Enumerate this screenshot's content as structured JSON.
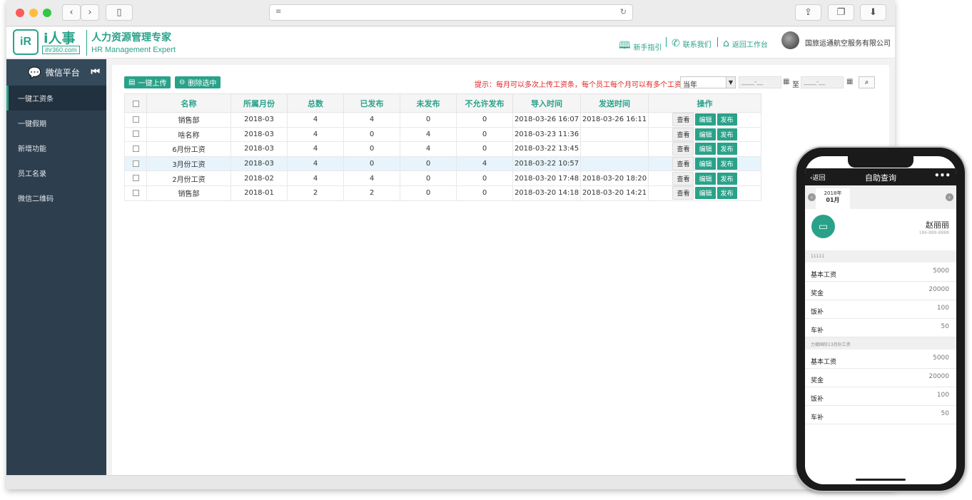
{
  "header": {
    "logo_name": "i人事",
    "logo_site": "ihr360.com",
    "brand_cn": "人力资源管理专家",
    "brand_en": "HR Management Expert",
    "links": [
      {
        "label": "新手指引",
        "icon": "book-icon"
      },
      {
        "label": "联系我们",
        "icon": "phone-icon"
      },
      {
        "label": "返回工作台",
        "icon": "home-icon"
      }
    ],
    "company": "国旅运通航空服务有限公司"
  },
  "sidebar": {
    "title": "微信平台",
    "items": [
      {
        "label": "一键工资条",
        "active": true
      },
      {
        "label": "一键假期",
        "active": false
      },
      {
        "label": "新增功能",
        "active": false
      },
      {
        "label": "员工名录",
        "active": false
      },
      {
        "label": "微信二维码",
        "active": false
      }
    ]
  },
  "toolbar": {
    "upload_label": "一键上传",
    "delete_label": "删除选中",
    "hint": "提示：每月可以多次上传工资条，每个员工每个月可以有多个工资条",
    "period_value": "当年",
    "date_from": "____-__",
    "date_to": "____-__",
    "to_label": "至"
  },
  "table": {
    "columns": [
      "名称",
      "所属月份",
      "总数",
      "已发布",
      "未发布",
      "不允许发布",
      "导入时间",
      "发送时间",
      "操作"
    ],
    "rows": [
      {
        "name": "销售部",
        "month": "2018-03",
        "total": "4",
        "published": "4",
        "unpublished": "0",
        "blocked": "0",
        "imported": "2018-03-26 16:07",
        "sent": "2018-03-26 16:11"
      },
      {
        "name": "啥名称",
        "month": "2018-03",
        "total": "4",
        "published": "0",
        "unpublished": "4",
        "blocked": "0",
        "imported": "2018-03-23 11:36",
        "sent": ""
      },
      {
        "name": "6月份工资",
        "month": "2018-03",
        "total": "4",
        "published": "0",
        "unpublished": "4",
        "blocked": "0",
        "imported": "2018-03-22 13:45",
        "sent": ""
      },
      {
        "name": "3月份工资",
        "month": "2018-03",
        "total": "4",
        "published": "0",
        "unpublished": "0",
        "blocked": "4",
        "imported": "2018-03-22 10:57",
        "sent": ""
      },
      {
        "name": "2月份工资",
        "month": "2018-02",
        "total": "4",
        "published": "4",
        "unpublished": "0",
        "blocked": "0",
        "imported": "2018-03-20 17:48",
        "sent": "2018-03-20 18:20"
      },
      {
        "name": "销售部",
        "month": "2018-01",
        "total": "2",
        "published": "2",
        "unpublished": "0",
        "blocked": "0",
        "imported": "2018-03-20 14:18",
        "sent": "2018-03-20 14:21"
      }
    ],
    "actions": {
      "view": "查看",
      "edit": "编辑",
      "publish": "发布"
    },
    "highlight_row": 3
  },
  "phone": {
    "back_label": "返回",
    "title": "自助查询",
    "more": "•••",
    "year": "2018年",
    "month": "01月",
    "employee_name": "赵丽丽",
    "employee_phone": "186-888-8888",
    "sections": [
      {
        "title": "11111",
        "items": [
          {
            "label": "基本工资",
            "value": "5000"
          },
          {
            "label": "奖金",
            "value": "20000"
          },
          {
            "label": "饭补",
            "value": "100"
          },
          {
            "label": "车补",
            "value": "50"
          }
        ]
      },
      {
        "title": "力德国际13月份工资",
        "items": [
          {
            "label": "基本工资",
            "value": "5000"
          },
          {
            "label": "奖金",
            "value": "20000"
          },
          {
            "label": "饭补",
            "value": "100"
          },
          {
            "label": "车补",
            "value": "50"
          }
        ]
      }
    ]
  },
  "colors": {
    "accent": "#2aa28a",
    "sidebar": "#2d3e4e",
    "hint": "#e21f1f",
    "highlight": "#e8f4fb"
  }
}
